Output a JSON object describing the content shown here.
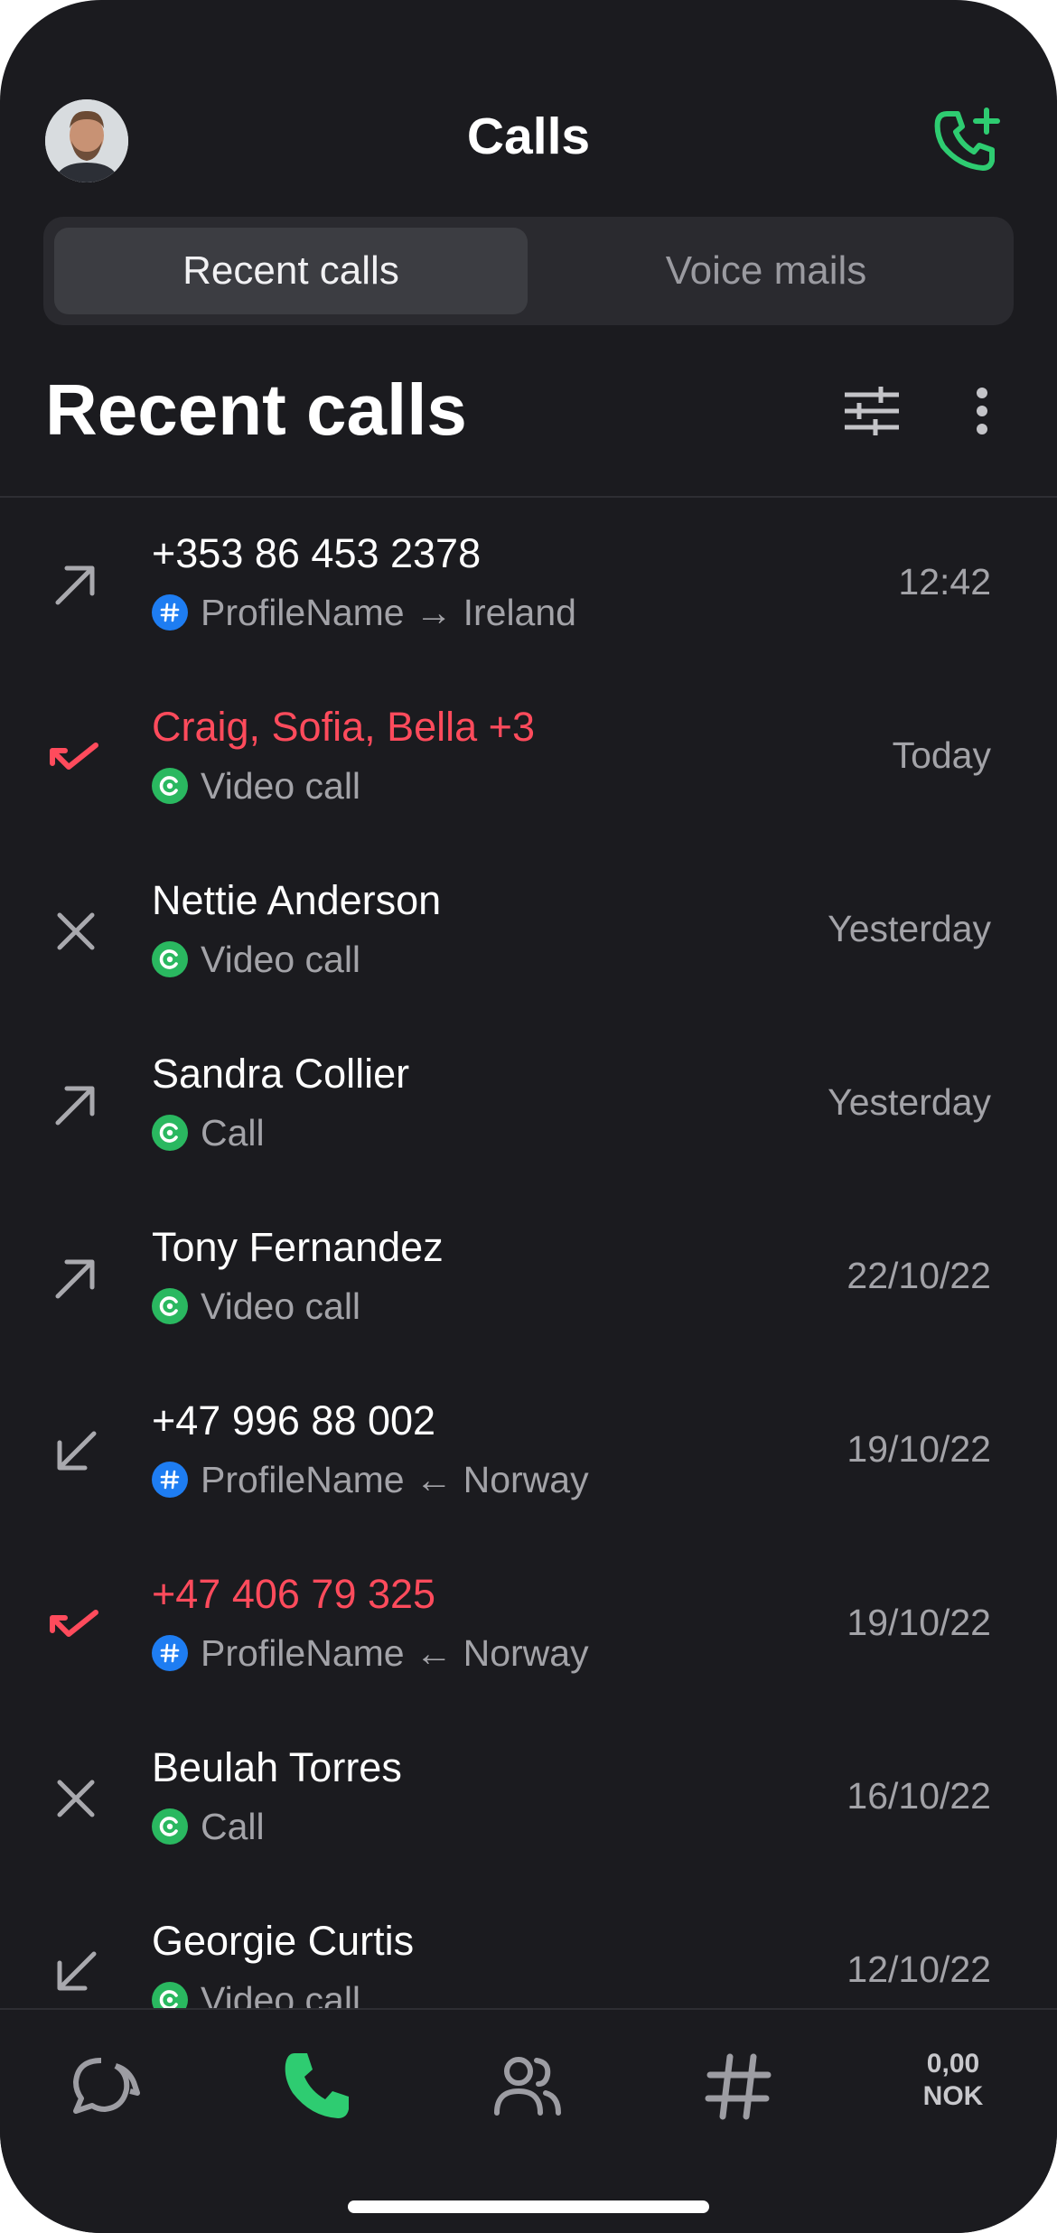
{
  "header": {
    "title": "Calls",
    "avatar_icon": "user-avatar",
    "add_call_icon": "phone-plus-icon",
    "accent_color": "#2ecc71"
  },
  "tabs": [
    {
      "label": "Recent calls",
      "active": true
    },
    {
      "label": "Voice mails",
      "active": false
    }
  ],
  "section": {
    "title": "Recent calls",
    "filter_icon": "sliders-icon",
    "more_icon": "more-vertical-icon"
  },
  "calls": [
    {
      "direction": "outgoing",
      "name": "+353 86 453 2378",
      "badge": "hash",
      "sub_profile": "ProfileName",
      "arrow": "→",
      "sub_country": "Ireland",
      "time": "12:42",
      "missed": false
    },
    {
      "direction": "missed",
      "name": "Craig, Sofia, Bella +3",
      "badge": "app",
      "sub": "Video call",
      "time": "Today",
      "missed": true
    },
    {
      "direction": "declined",
      "name": "Nettie Anderson",
      "badge": "app",
      "sub": "Video call",
      "time": "Yesterday",
      "missed": false
    },
    {
      "direction": "outgoing",
      "name": "Sandra Collier",
      "badge": "app",
      "sub": "Call",
      "time": "Yesterday",
      "missed": false
    },
    {
      "direction": "outgoing",
      "name": "Tony Fernandez",
      "badge": "app",
      "sub": "Video call",
      "time": "22/10/22",
      "missed": false
    },
    {
      "direction": "incoming",
      "name": "+47 996 88 002",
      "badge": "hash",
      "sub_profile": "ProfileName",
      "arrow": "←",
      "sub_country": "Norway",
      "time": "19/10/22",
      "missed": false
    },
    {
      "direction": "missed",
      "name": "+47 406 79 325",
      "badge": "hash",
      "sub_profile": "ProfileName",
      "arrow": "←",
      "sub_country": "Norway",
      "time": "19/10/22",
      "missed": true
    },
    {
      "direction": "declined",
      "name": "Beulah Torres",
      "badge": "app",
      "sub": "Call",
      "time": "16/10/22",
      "missed": false
    },
    {
      "direction": "incoming",
      "name": "Georgie Curtis",
      "badge": "app",
      "sub": "Video call",
      "time": "12/10/22",
      "missed": false
    }
  ],
  "nav": {
    "items": [
      {
        "icon": "chat-icon",
        "active": false
      },
      {
        "icon": "phone-icon",
        "active": true
      },
      {
        "icon": "contacts-icon",
        "active": false
      },
      {
        "icon": "hash-icon",
        "active": false
      }
    ],
    "balance_amount": "0,00",
    "balance_currency": "NOK"
  },
  "colors": {
    "background": "#1b1b1f",
    "missed": "#ff4b5c",
    "blue_badge": "#1e7df2",
    "green_badge": "#2ab860"
  }
}
